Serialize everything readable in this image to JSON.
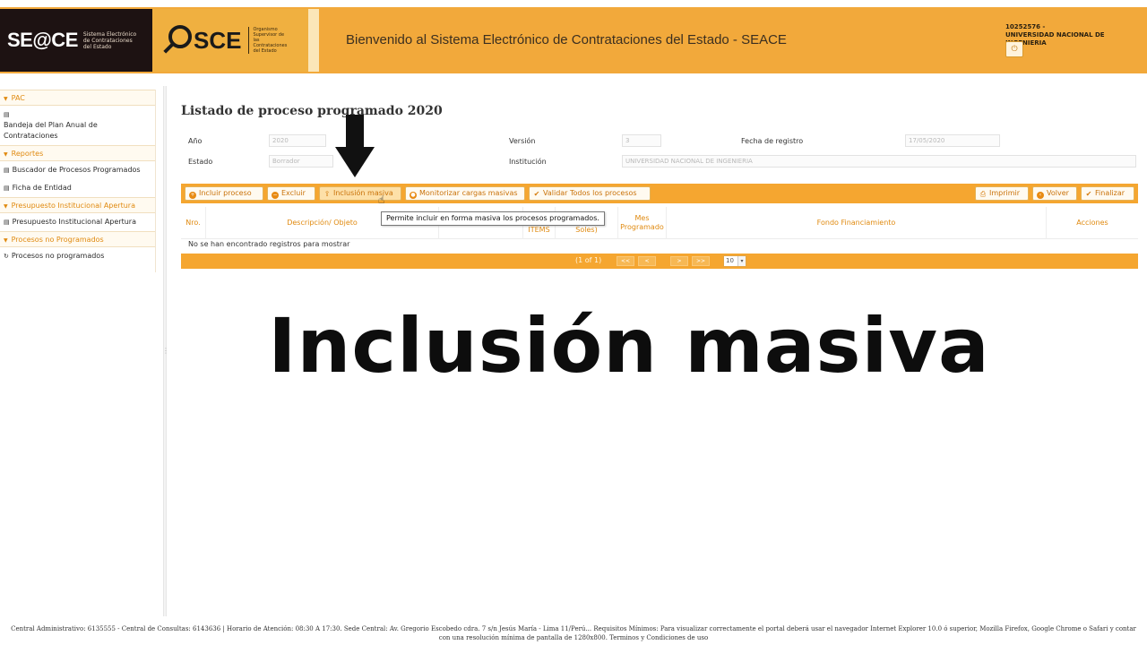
{
  "header": {
    "seace_logo": "SE@CE",
    "seace_subtitle": "Sistema Electrónico de Contrataciones del Estado",
    "osce_logo": "SCE",
    "osce_subtitle": "Organismo Supervisor de las Contrataciones del Estado",
    "welcome": "Bienvenido al Sistema Electrónico de Contrataciones del Estado - SEACE",
    "user_code": "10252576 -",
    "user_entity": "UNIVERSIDAD NACIONAL DE INGENIERIA",
    "power_icon": "power-icon"
  },
  "sidebar": {
    "sections": [
      {
        "title": "PAC",
        "items": [
          "Bandeja del Plan Anual de Contrataciones"
        ]
      },
      {
        "title": "Reportes",
        "items": [
          "Buscador de Procesos Programados",
          "Ficha de Entidad"
        ]
      },
      {
        "title": "Presupuesto Institucional Apertura",
        "items": [
          "Presupuesto Institucional Apertura"
        ]
      },
      {
        "title": "Procesos no Programados",
        "items": [
          "Procesos no programados"
        ]
      }
    ]
  },
  "main": {
    "title": "Listado de proceso programado 2020",
    "fields": {
      "anio_label": "Año",
      "anio_value": "2020",
      "version_label": "Versión",
      "version_value": "3",
      "fecha_label": "Fecha de registro",
      "fecha_value": "17/05/2020",
      "estado_label": "Estado",
      "estado_value": "Borrador",
      "institucion_label": "Institución",
      "institucion_value": "UNIVERSIDAD NACIONAL DE INGENIERIA"
    },
    "toolbar": {
      "incluir": "Incluir proceso",
      "excluir": "Excluir",
      "inclusion_masiva": "Inclusión masiva",
      "monitorizar": "Monitorizar cargas masivas",
      "validar": "Validar Todos los procesos",
      "imprimir": "Imprimir",
      "volver": "Volver",
      "finalizar": "Finalizar"
    },
    "tooltip": "Permite incluir en forma masiva los procesos programados.",
    "grid": {
      "col_nro": "Nro.",
      "col_desc": "Descripción/ Objeto",
      "col_items": "ITEMS",
      "col_soles": "Soles)",
      "col_mes": "Mes Programado",
      "col_fondo": "Fondo Financiamiento",
      "col_acciones": "Acciones",
      "empty": "No se han encontrado registros para mostrar"
    },
    "pager": {
      "text": "(1 of 1)",
      "first": "<<",
      "prev": "<",
      "next": ">",
      "last": ">>",
      "page_size": "10"
    }
  },
  "caption": "Inclusión masiva",
  "footer": "Central Administrativo: 6135555 - Central de Consultas: 6143636 | Horario de Atención: 08:30 A 17:30. Sede Central: Av. Gregorio Escobedo cdra. 7 s/n Jesús María - Lima 11/Perú... Requisitos Mínimos: Para visualizar correctamente el portal deberá usar el navegador Internet Explorer 10.0 ó superior, Mozilla Firefox, Google Chrome o Safari y contar con una resolución mínima de pantalla de 1280x800. Terminos y Condiciones de uso"
}
